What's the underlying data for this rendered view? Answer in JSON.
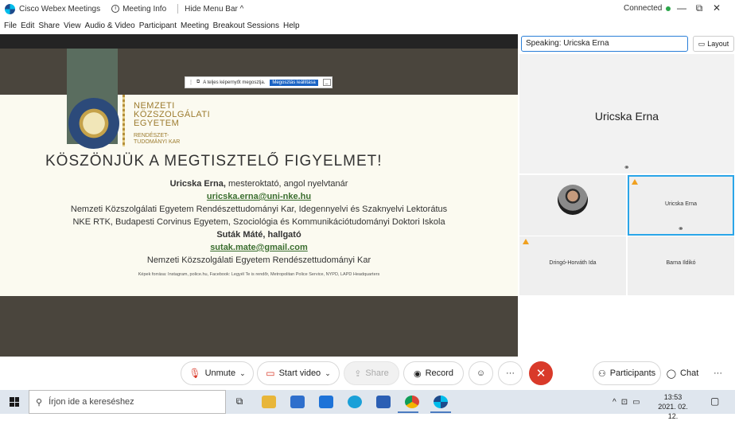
{
  "titlebar": {
    "app_name": "Cisco Webex Meetings",
    "meeting_info": "Meeting Info",
    "hide_menu": "Hide Menu Bar ^",
    "status": "Connected",
    "status_color": "#2ca64a",
    "minimize": "—",
    "restore": "⧉",
    "close": "✕"
  },
  "menu": [
    "File",
    "Edit",
    "Share",
    "View",
    "Audio & Video",
    "Participant",
    "Meeting",
    "Breakout Sessions",
    "Help"
  ],
  "share_bar": {
    "text": "A teljes képernyőt megosztja.",
    "stop_label": "Megosztás leállítása",
    "min_label": "_"
  },
  "slide": {
    "logo_lines": [
      "NEMZETI",
      "KÖZSZOLGÁLATI",
      "EGYETEM"
    ],
    "logo_sub": [
      "RENDÉSZET-",
      "TUDOMÁNYI KAR"
    ],
    "title": "KÖSZÖNJÜK A MEGTISZTELŐ FIGYELMET!",
    "speaker1_name": "Uricska Erna,",
    "speaker1_role": " mesteroktató, angol nyelvtanár",
    "speaker1_email": "uricska.erna@uni-nke.hu",
    "speaker1_aff1": "Nemzeti Közszolgálati Egyetem Rendészettudományi Kar, Idegennyelvi és Szaknyelvi Lektorátus",
    "speaker1_aff2": "NKE RTK, Budapesti Corvinus Egyetem, Szociológia és Kommunikációtudományi Doktori Iskola",
    "speaker2": "Suták Máté, hallgató",
    "speaker2_email": "sutak.mate@gmail.com",
    "speaker2_aff": "Nemzeti Közszolgálati Egyetem Rendészettudományi Kar",
    "credits": "Képek forrása: Instagram, police.hu, Facebook: Legyél Te is rendőr, Metropolitan Police Service, NYPD, LAPD Headquarters"
  },
  "right_panel": {
    "speaking_prefix": "Speaking: ",
    "speaking_name": "Uricska Erna",
    "layout_label": "Layout",
    "active_name": "Uricska Erna",
    "tiles": [
      {
        "name": ""
      },
      {
        "name": "Uricska Erna"
      },
      {
        "name": "Dringó-Horváth Ida"
      },
      {
        "name": "Barna Ildikó"
      }
    ]
  },
  "controls": {
    "unmute": "Unmute",
    "start_video": "Start video",
    "share": "Share",
    "record": "Record",
    "participants": "Participants",
    "chat": "Chat",
    "more": "···"
  },
  "taskbar": {
    "search_placeholder": "Írjon ide a kereséshez",
    "time": "13:53",
    "date": "2021. 02. 12."
  }
}
